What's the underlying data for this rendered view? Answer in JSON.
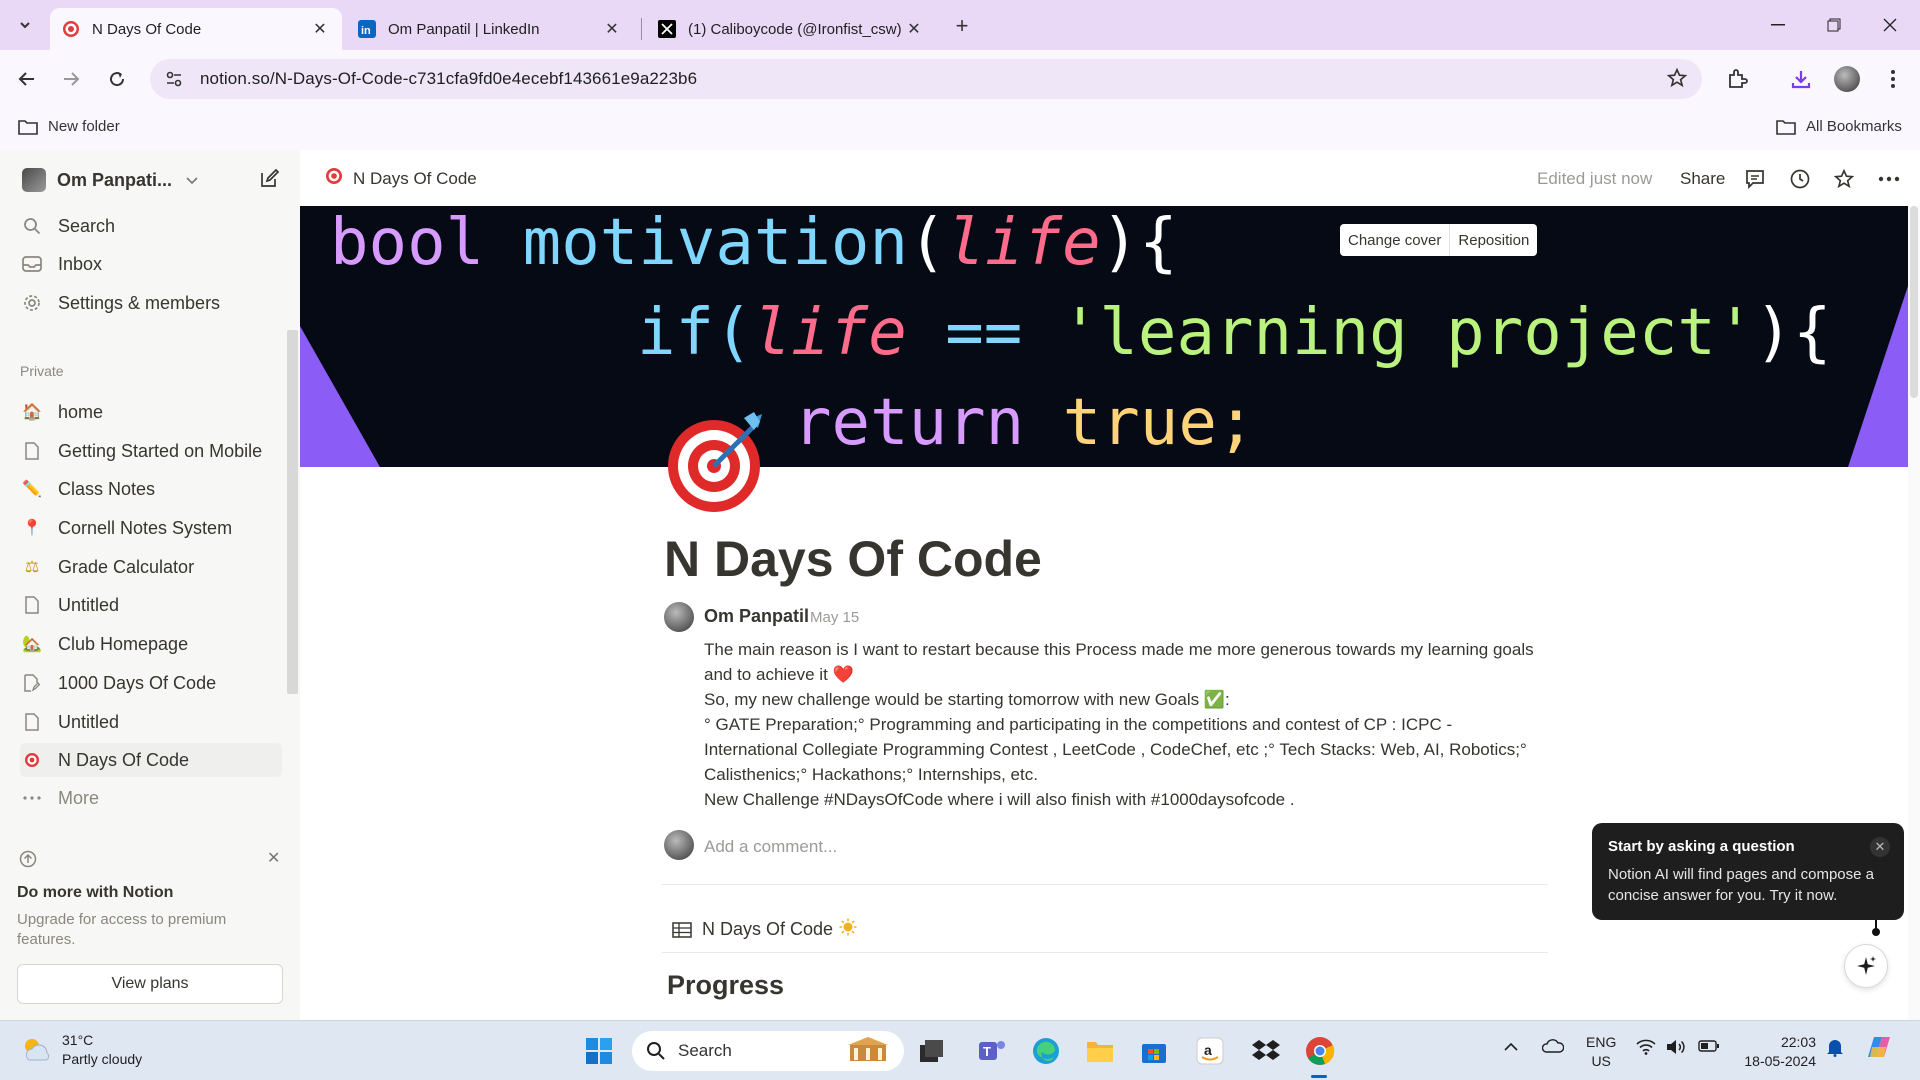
{
  "browser": {
    "tabs": [
      {
        "title": "N Days Of Code",
        "icon": "target-icon",
        "active": true
      },
      {
        "title": "Om Panpatil | LinkedIn",
        "icon": "linkedin-icon",
        "active": false
      },
      {
        "title": "(1) Caliboycode (@Ironfist_csw)",
        "icon": "x-icon",
        "active": false
      }
    ],
    "url": "notion.so/N-Days-Of-Code-c731cfa9fd0e4ecebf143661e9a223b6",
    "bookmarks": {
      "folder": "New folder",
      "all": "All Bookmarks"
    },
    "accent": "#e9d9f7"
  },
  "sidebar": {
    "workspace": "Om Panpati...",
    "top_items": [
      {
        "label": "Search",
        "icon": "search-icon"
      },
      {
        "label": "Inbox",
        "icon": "inbox-icon"
      },
      {
        "label": "Settings & members",
        "icon": "gear-icon"
      }
    ],
    "section": "Private",
    "pages": [
      {
        "label": "home",
        "icon": "house-icon",
        "glyph": "🏠"
      },
      {
        "label": "Getting Started on Mobile",
        "icon": "page-icon",
        "glyph": "🗋"
      },
      {
        "label": "Class Notes",
        "icon": "pencil-icon",
        "glyph": "✏️"
      },
      {
        "label": "Cornell Notes System",
        "icon": "pushpin-icon",
        "glyph": "📍"
      },
      {
        "label": "Grade Calculator",
        "icon": "scales-icon",
        "glyph": "⚖"
      },
      {
        "label": "Untitled",
        "icon": "page-icon",
        "glyph": "🗋"
      },
      {
        "label": "Club Homepage",
        "icon": "house-icon",
        "glyph": "🏡"
      },
      {
        "label": "1000 Days Of Code",
        "icon": "page-edit-icon",
        "glyph": "🗋"
      },
      {
        "label": "Untitled",
        "icon": "page-icon",
        "glyph": "🗋"
      },
      {
        "label": "N Days Of Code",
        "icon": "target-icon",
        "glyph": "🎯"
      }
    ],
    "more": "More",
    "upsell": {
      "title": "Do more with Notion",
      "body": "Upgrade for access to premium features.",
      "button": "View plans"
    }
  },
  "page": {
    "breadcrumb": "N Days Of Code",
    "edited": "Edited just now",
    "share": "Share",
    "cover_buttons": {
      "change": "Change cover",
      "reposition": "Reposition"
    },
    "cover_code": {
      "line1": [
        "bool",
        "motivation",
        "(",
        "life",
        "){"
      ],
      "line2": [
        "if(",
        "life",
        " == ",
        "'learning project'",
        "){"
      ],
      "line3": [
        "return",
        "true;"
      ]
    },
    "title": "N Days Of Code",
    "comment": {
      "author": "Om Panpatil",
      "date": "May 15",
      "lines": [
        "The main reason is I want to restart because this Process made me more generous towards my learning goals and to achieve it ❤️",
        "So, my new challenge would be starting tomorrow with new Goals ✅:",
        "° GATE Preparation;° Programming and participating in the competitions and contest of CP : ICPC - International Collegiate Programming Contest , LeetCode , CodeChef, etc ;° Tech Stacks: Web, AI, Robotics;° Calisthenics;° Hackathons;° Internships, etc.",
        "New Challenge #NDaysOfCode where i will also finish with #1000daysofcode ."
      ]
    },
    "add_comment_placeholder": "Add a comment...",
    "database_title": "N Days Of Code",
    "section_heading": "Progress"
  },
  "ai_popup": {
    "title": "Start by asking a question",
    "body": "Notion AI will find pages and compose a concise answer for you. Try it now."
  },
  "taskbar": {
    "weather": {
      "temp": "31°C",
      "desc": "Partly cloudy"
    },
    "search_placeholder": "Search",
    "lang": {
      "line1": "ENG",
      "line2": "US"
    },
    "clock": {
      "time": "22:03",
      "date": "18-05-2024"
    }
  }
}
